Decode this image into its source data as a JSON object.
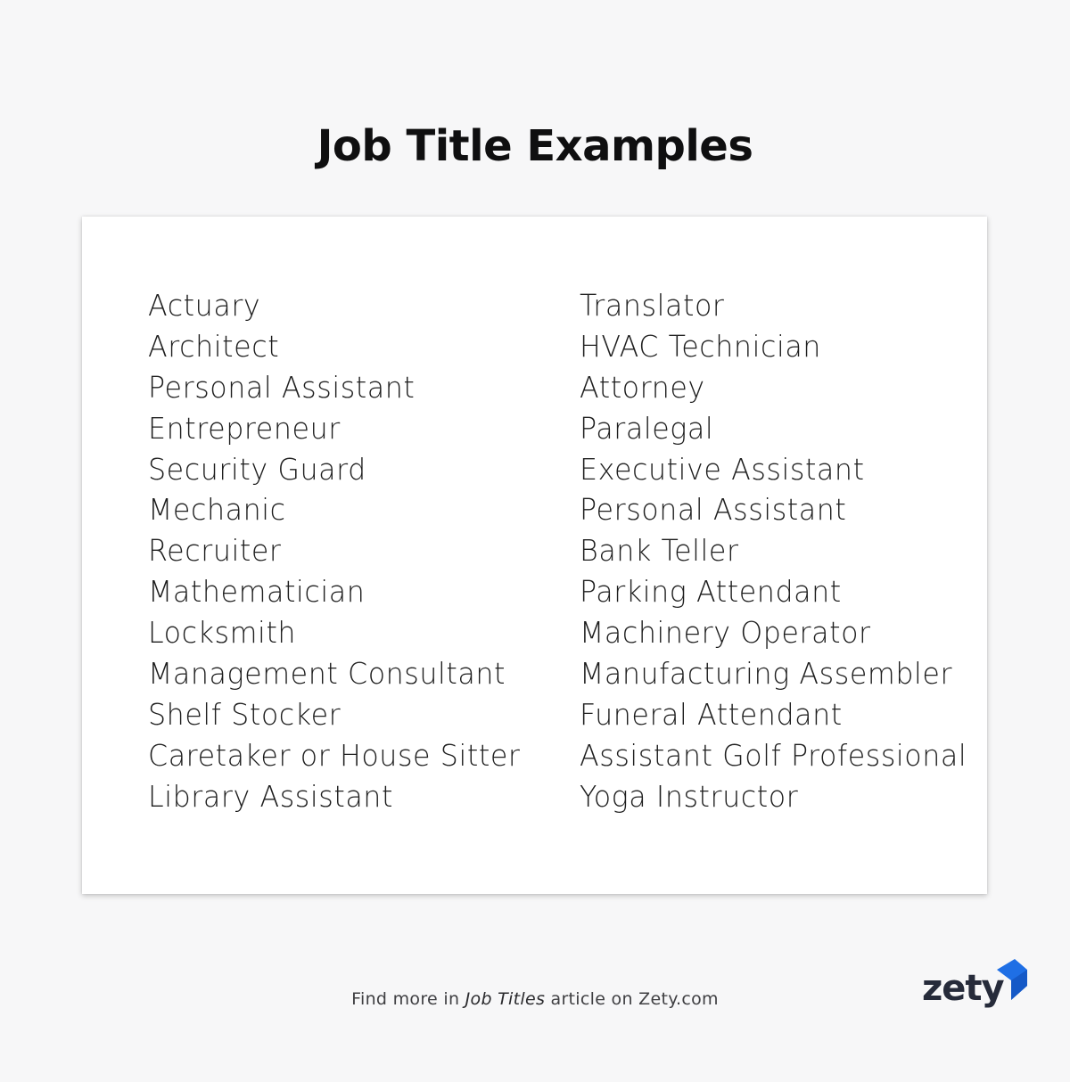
{
  "header": {
    "title": "Job Title Examples"
  },
  "card": {
    "left_column": [
      "Actuary",
      "Architect",
      "Personal Assistant",
      "Entrepreneur",
      "Security Guard",
      "Mechanic",
      "Recruiter",
      "Mathematician",
      "Locksmith",
      "Management Consultant",
      "Shelf Stocker",
      "Caretaker or House Sitter",
      "Library Assistant"
    ],
    "right_column": [
      "Translator",
      "HVAC Technician",
      "Attorney",
      "Paralegal",
      "Executive Assistant",
      "Personal Assistant",
      "Bank Teller",
      "Parking Attendant",
      "Machinery Operator",
      "Manufacturing Assembler",
      "Funeral Attendant",
      "Assistant Golf Professional",
      "Yoga Instructor"
    ]
  },
  "footer": {
    "prefix": "Find more in ",
    "link_text": "Job Titles",
    "suffix": " article on Zety.com"
  },
  "logo": {
    "text": "zety",
    "icon": "zety-logo-mark-icon",
    "accent_color": "#1f6fe5",
    "accent_dark": "#1559c7",
    "text_color": "#262b3a"
  },
  "colors": {
    "background": "#f7f7f8",
    "card": "#ffffff",
    "text": "#1e1e1e"
  }
}
